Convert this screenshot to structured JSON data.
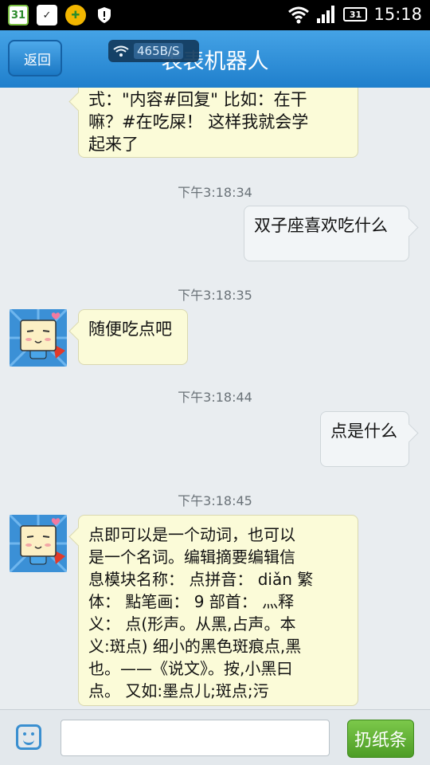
{
  "status_bar": {
    "time": "15:18",
    "battery": "31",
    "calendar_day": "31",
    "icons": [
      "calendar-icon",
      "check-icon",
      "plus-icon",
      "shield-icon",
      "wifi-icon",
      "signal-icon",
      "battery-icon"
    ]
  },
  "header": {
    "back_label": "返回",
    "title": "表表机器人",
    "net_speed": "465B/S"
  },
  "messages": [
    {
      "kind": "bubble",
      "side": "left",
      "lines": [
        "式：\"内容#回复\" 比如：在干",
        "嘛？#在吃屎！ 这样我就会学",
        "起来了"
      ]
    },
    {
      "kind": "time",
      "text": "下午3:18:34"
    },
    {
      "kind": "bubble",
      "side": "right",
      "lines": [
        "双子座喜欢吃什么"
      ]
    },
    {
      "kind": "time",
      "text": "下午3:18:35"
    },
    {
      "kind": "bubble",
      "side": "left",
      "lines": [
        "随便吃点吧"
      ]
    },
    {
      "kind": "time",
      "text": "下午3:18:44"
    },
    {
      "kind": "bubble",
      "side": "right",
      "lines": [
        "点是什么"
      ]
    },
    {
      "kind": "time",
      "text": "下午3:18:45"
    },
    {
      "kind": "bubble",
      "side": "left",
      "lines": [
        "点即可以是一个动词，也可以",
        "是一个名词。编辑摘要编辑信",
        "息模块名称： 点拼音： diǎn 繁",
        "体： 點笔画： 9 部首： 灬释",
        "义： 点(形声。从黑,占声。本",
        "义:斑点) 细小的黑色斑痕点,黑",
        "也。——《说文》。按,小黑曰",
        "点。 又如:墨点儿;斑点;污"
      ]
    }
  ],
  "input_bar": {
    "placeholder": "",
    "value": "",
    "send_label": "扔纸条"
  },
  "colors": {
    "header": "#2d8fd8",
    "left_bubble": "#fbfbd8",
    "right_bubble": "#f2f5f7",
    "send_button": "#5fae33"
  }
}
